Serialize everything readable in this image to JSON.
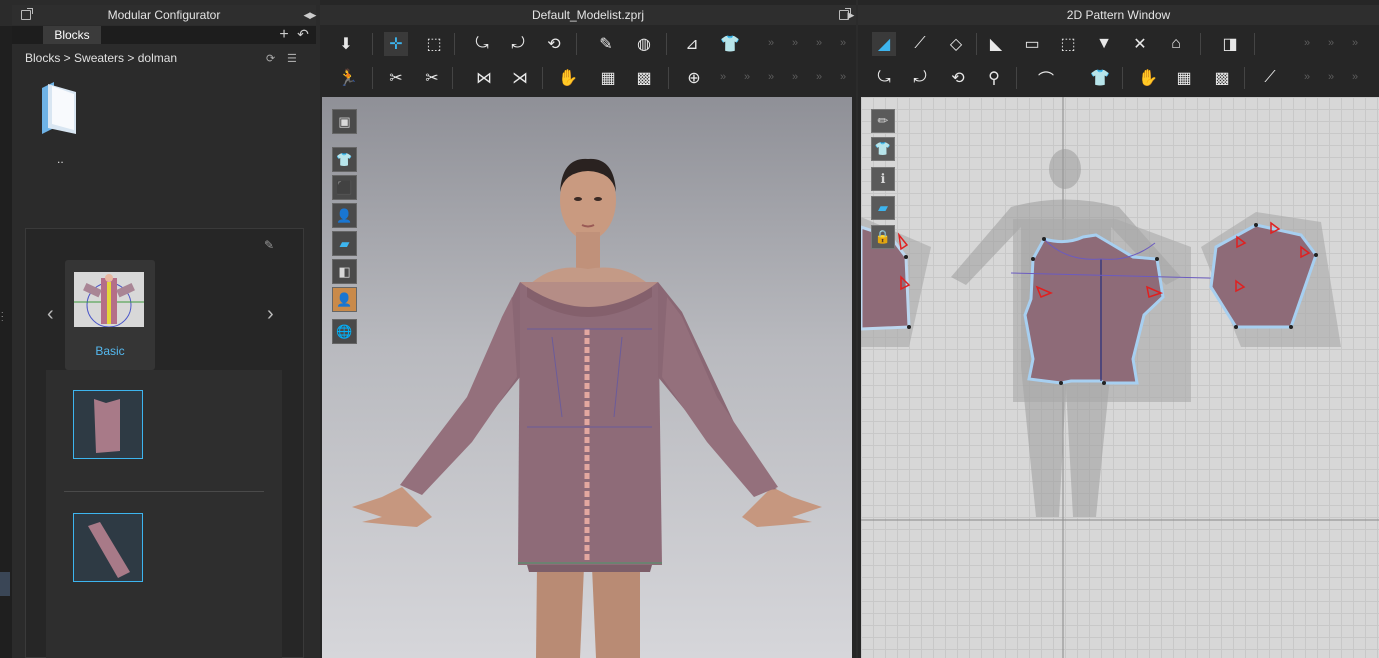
{
  "left_panel": {
    "title": "Modular Configurator",
    "tab": "Blocks",
    "breadcrumb": "Blocks > Sweaters > dolman",
    "parent_folder_label": "..",
    "block_style_label": "Basic"
  },
  "viewport3d": {
    "title": "Default_Modelist.zprj"
  },
  "pattern_window": {
    "title": "2D Pattern Window"
  },
  "colors": {
    "accent": "#3db5ef",
    "garment": "#8e6b78",
    "pattern_bg": "#d7d7d7",
    "panel_bg": "#2b2b2b"
  }
}
